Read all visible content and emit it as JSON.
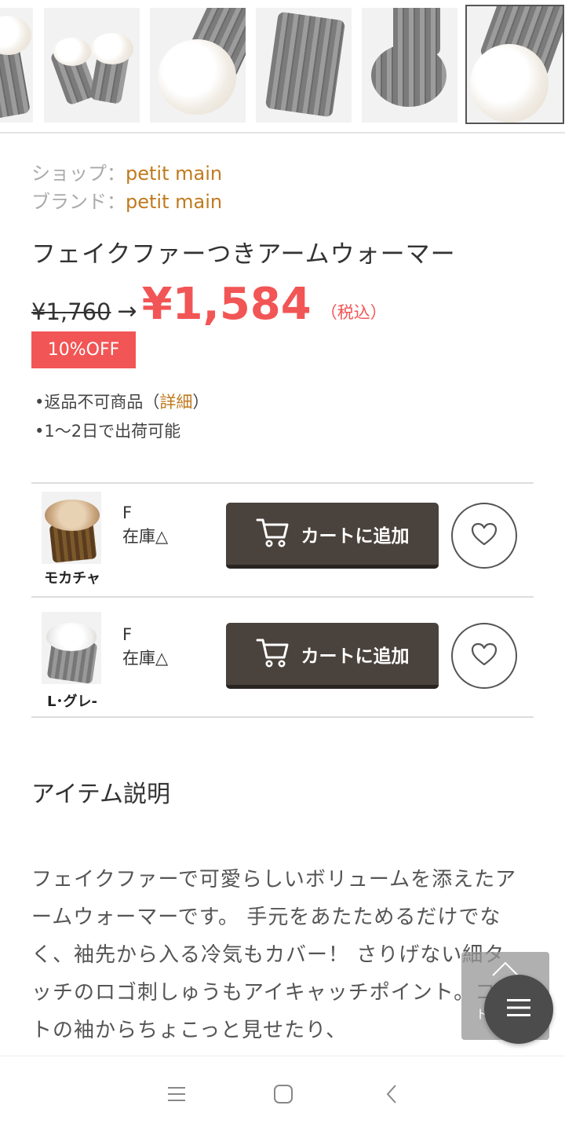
{
  "gallery": {
    "thumbnails": [
      {
        "name": "thumbnail-1"
      },
      {
        "name": "thumbnail-2"
      },
      {
        "name": "thumbnail-3"
      },
      {
        "name": "thumbnail-4"
      },
      {
        "name": "thumbnail-5"
      },
      {
        "name": "thumbnail-6",
        "selected": true
      }
    ]
  },
  "shop": {
    "shop_label": "ショップ：",
    "shop_value": "petit main",
    "brand_label": "ブランド：",
    "brand_value": "petit main"
  },
  "product": {
    "title": "フェイクファーつきアームウォーマー",
    "old_price": "¥1,760",
    "arrow": "→",
    "new_price": "¥1,584",
    "tax_note": "（税込）",
    "discount_badge": "10%OFF",
    "note1_prefix": "•返品不可商品（",
    "note1_link": "詳細",
    "note1_suffix": "）",
    "note2": "•1〜2日で出荷可能"
  },
  "variants": [
    {
      "color_name": "モカチャ",
      "size": "F",
      "stock": "在庫△",
      "cart_label": "カートに追加"
    },
    {
      "color_name": "L･グレ-",
      "size": "F",
      "stock": "在庫△",
      "cart_label": "カートに追加"
    }
  ],
  "description": {
    "heading": "アイテム説明",
    "text": "フェイクファーで可愛らしいボリュームを添えたアームウォーマーです。 手元をあたためるだけでなく、袖先から入る冷気もカバー！ さりげない細タッチのロゴ刺しゅうもアイキャッチポイント。コートの袖からちょこっと見せたり、"
  },
  "floating": {
    "top_label": "トップへ"
  },
  "colors": {
    "accent_price": "#f25555",
    "link": "#c07a1e",
    "cart_button": "#4a423c"
  },
  "icons": [
    "cart-icon",
    "heart-icon",
    "menu-icon",
    "arrow-up-icon",
    "nav-recents-icon",
    "nav-home-icon",
    "nav-back-icon"
  ]
}
